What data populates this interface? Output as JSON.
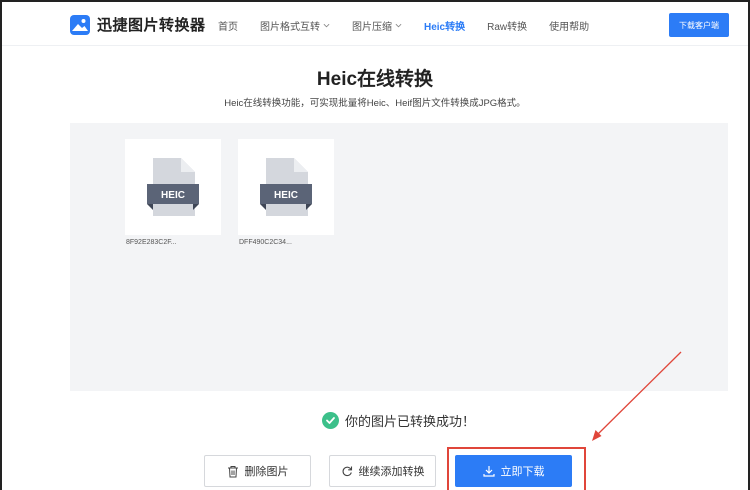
{
  "header": {
    "app_name": "迅捷图片转换器",
    "nav": [
      {
        "label": "首页",
        "has_dropdown": false,
        "active": false
      },
      {
        "label": "图片格式互转",
        "has_dropdown": true,
        "active": false
      },
      {
        "label": "图片压缩",
        "has_dropdown": true,
        "active": false
      },
      {
        "label": "Heic转换",
        "has_dropdown": false,
        "active": true
      },
      {
        "label": "Raw转换",
        "has_dropdown": false,
        "active": false
      },
      {
        "label": "使用帮助",
        "has_dropdown": false,
        "active": false
      }
    ],
    "download_client_label": "下载客户端"
  },
  "main": {
    "title": "Heic在线转换",
    "subtitle": "Heic在线转换功能，可实现批量将Heic、Heif图片文件转换成JPG格式。",
    "files": [
      {
        "badge": "HEIC",
        "name": "8F92E283C2F..."
      },
      {
        "badge": "HEIC",
        "name": "DFF490C2C34..."
      }
    ],
    "success_message": "你的图片已转换成功！"
  },
  "actions": {
    "delete_label": "删除图片",
    "continue_label": "继续添加转换",
    "download_label": "立即下载"
  },
  "colors": {
    "accent": "#2c7cf6",
    "success": "#3cc08a",
    "annotation": "#e0463a",
    "file_icon_badge": "#5b6477"
  }
}
